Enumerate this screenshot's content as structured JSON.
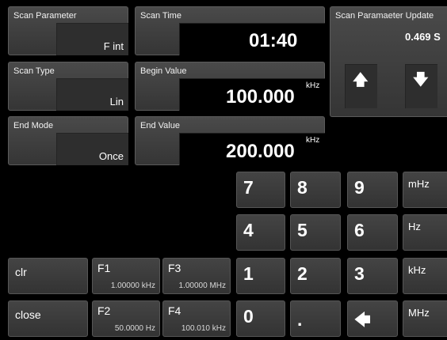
{
  "scan_parameter": {
    "label": "Scan Parameter",
    "value": "F int"
  },
  "scan_time": {
    "label": "Scan Time",
    "value": "01:40"
  },
  "scan_type": {
    "label": "Scan Type",
    "value": "Lin"
  },
  "begin_value": {
    "label": "Begin Value",
    "value": "100.000",
    "unit": "kHz"
  },
  "end_mode": {
    "label": "End Mode",
    "value": "Once"
  },
  "end_value": {
    "label": "End Value",
    "value": "200.000",
    "unit": "kHz"
  },
  "update": {
    "label": "Scan Paramaeter Update",
    "value": "0.469 S",
    "up_icon": "arrow-up",
    "down_icon": "arrow-down"
  },
  "keypad": {
    "k7": "7",
    "k8": "8",
    "k9": "9",
    "k4": "4",
    "k5": "5",
    "k6": "6",
    "k1": "1",
    "k2": "2",
    "k3": "3",
    "k0": "0",
    "dot": ".",
    "backspace_icon": "arrow-left"
  },
  "units": {
    "mhz_milli": "mHz",
    "hz": "Hz",
    "khz": "kHz",
    "mhz_mega": "MHz"
  },
  "actions": {
    "clr": "clr",
    "close": "close"
  },
  "fkeys": {
    "f1": {
      "label": "F1",
      "value": "1.00000 kHz"
    },
    "f2": {
      "label": "F2",
      "value": "50.0000 Hz"
    },
    "f3": {
      "label": "F3",
      "value": "1.00000 MHz"
    },
    "f4": {
      "label": "F4",
      "value": "100.010 kHz"
    }
  },
  "colors": {
    "background": "#000000",
    "panel": "#404040",
    "field": "#000000"
  }
}
